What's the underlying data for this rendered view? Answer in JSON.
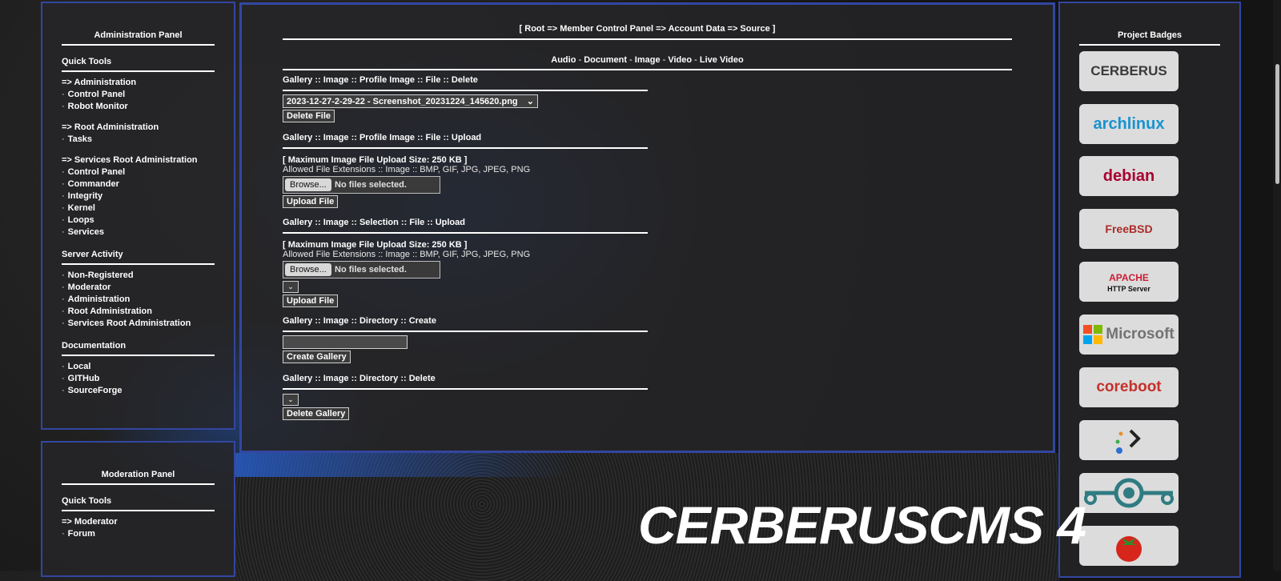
{
  "admin_panel": {
    "title": "Administration Panel",
    "sections": [
      {
        "heading": "Quick Tools",
        "items": [
          {
            "label": "=> Administration",
            "bullet": false,
            "gap": false
          },
          {
            "label": "Control Panel",
            "bullet": true,
            "gap": false
          },
          {
            "label": "Robot Monitor",
            "bullet": true,
            "gap": false
          },
          {
            "label": "=> Root Administration",
            "bullet": false,
            "gap": true
          },
          {
            "label": "Tasks",
            "bullet": true,
            "gap": false
          },
          {
            "label": "=> Services Root Administration",
            "bullet": false,
            "gap": true
          },
          {
            "label": "Control Panel",
            "bullet": true,
            "gap": false
          },
          {
            "label": "Commander",
            "bullet": true,
            "gap": false
          },
          {
            "label": "Integrity",
            "bullet": true,
            "gap": false
          },
          {
            "label": "Kernel",
            "bullet": true,
            "gap": false
          },
          {
            "label": "Loops",
            "bullet": true,
            "gap": false
          },
          {
            "label": "Services",
            "bullet": true,
            "gap": false
          }
        ]
      },
      {
        "heading": "Server Activity",
        "items": [
          {
            "label": "Non-Registered",
            "bullet": true,
            "gap": false
          },
          {
            "label": "Moderator",
            "bullet": true,
            "gap": false
          },
          {
            "label": "Administration",
            "bullet": true,
            "gap": false
          },
          {
            "label": "Root Administration",
            "bullet": true,
            "gap": false
          },
          {
            "label": "Services Root Administration",
            "bullet": true,
            "gap": false
          }
        ]
      },
      {
        "heading": "Documentation",
        "items": [
          {
            "label": "Local",
            "bullet": true,
            "gap": false
          },
          {
            "label": "GITHub",
            "bullet": true,
            "gap": false
          },
          {
            "label": "SourceForge",
            "bullet": true,
            "gap": false
          }
        ]
      }
    ]
  },
  "moderation_panel": {
    "title": "Moderation Panel",
    "section_heading": "Quick Tools",
    "items": [
      {
        "label": "=> Moderator",
        "bullet": false
      },
      {
        "label": "Forum",
        "bullet": true
      }
    ]
  },
  "main": {
    "breadcrumb": {
      "open": "[",
      "trail": "Root => Member Control Panel => Account Data => Source",
      "close": "]"
    },
    "media_nav": [
      "Audio",
      "Document",
      "Image",
      "Video",
      "Live Video"
    ],
    "media_sep": " - ",
    "forms": {
      "delete_file": {
        "title": "Gallery :: Image :: Profile Image :: File :: Delete",
        "select_value": "2023-12-27-2-29-22 - Screenshot_20231224_145620.png",
        "button": "Delete File"
      },
      "upload_profile": {
        "title": "Gallery :: Image :: Profile Image :: File :: Upload",
        "max_size": "[ Maximum Image File Upload Size: 250 KB ]",
        "extensions": "Allowed File Extensions :: Image :: BMP, GIF, JPG, JPEG, PNG",
        "browse": "Browse...",
        "no_file": "No files selected.",
        "button": "Upload File"
      },
      "upload_selection": {
        "title": "Gallery :: Image :: Selection :: File :: Upload",
        "max_size": "[ Maximum Image File Upload Size: 250 KB ]",
        "extensions": "Allowed File Extensions :: Image :: BMP, GIF, JPG, JPEG, PNG",
        "browse": "Browse...",
        "no_file": "No files selected.",
        "button": "Upload File"
      },
      "dir_create": {
        "title": "Gallery :: Image :: Directory :: Create",
        "input_value": "",
        "button": "Create Gallery"
      },
      "dir_delete": {
        "title": "Gallery :: Image :: Directory :: Delete",
        "button": "Delete Gallery"
      }
    }
  },
  "badges": {
    "title": "Project Badges",
    "items": [
      {
        "label": "CERBERUS",
        "color": "#3a3a3a",
        "icon": "cerberus-badge-icon"
      },
      {
        "label": "archlinux",
        "color": "#1793d1",
        "icon": "archlinux-badge-icon"
      },
      {
        "label": "debian",
        "color": "#a80030",
        "icon": "debian-badge-icon"
      },
      {
        "label": "FreeBSD",
        "color": "#ab2b28",
        "icon": "freebsd-badge-icon"
      },
      {
        "label": "APACHE",
        "sublabel": "HTTP Server",
        "color": "#c92037",
        "icon": "apache-badge-icon"
      },
      {
        "label": "Microsoft",
        "color": "#737373",
        "icon": "microsoft-badge-icon"
      },
      {
        "label": "coreboot",
        "color": "#c4302b",
        "icon": "coreboot-badge-icon"
      },
      {
        "label": "",
        "color": "#3a3a3a",
        "icon": "terminal-badge-icon"
      },
      {
        "label": "",
        "color": "#2f7c82",
        "icon": "lineageos-badge-icon"
      },
      {
        "label": "",
        "color": "#d6261c",
        "icon": "tomato-badge-icon"
      }
    ]
  },
  "logo": {
    "text": "CERBERUSCMS 4"
  }
}
